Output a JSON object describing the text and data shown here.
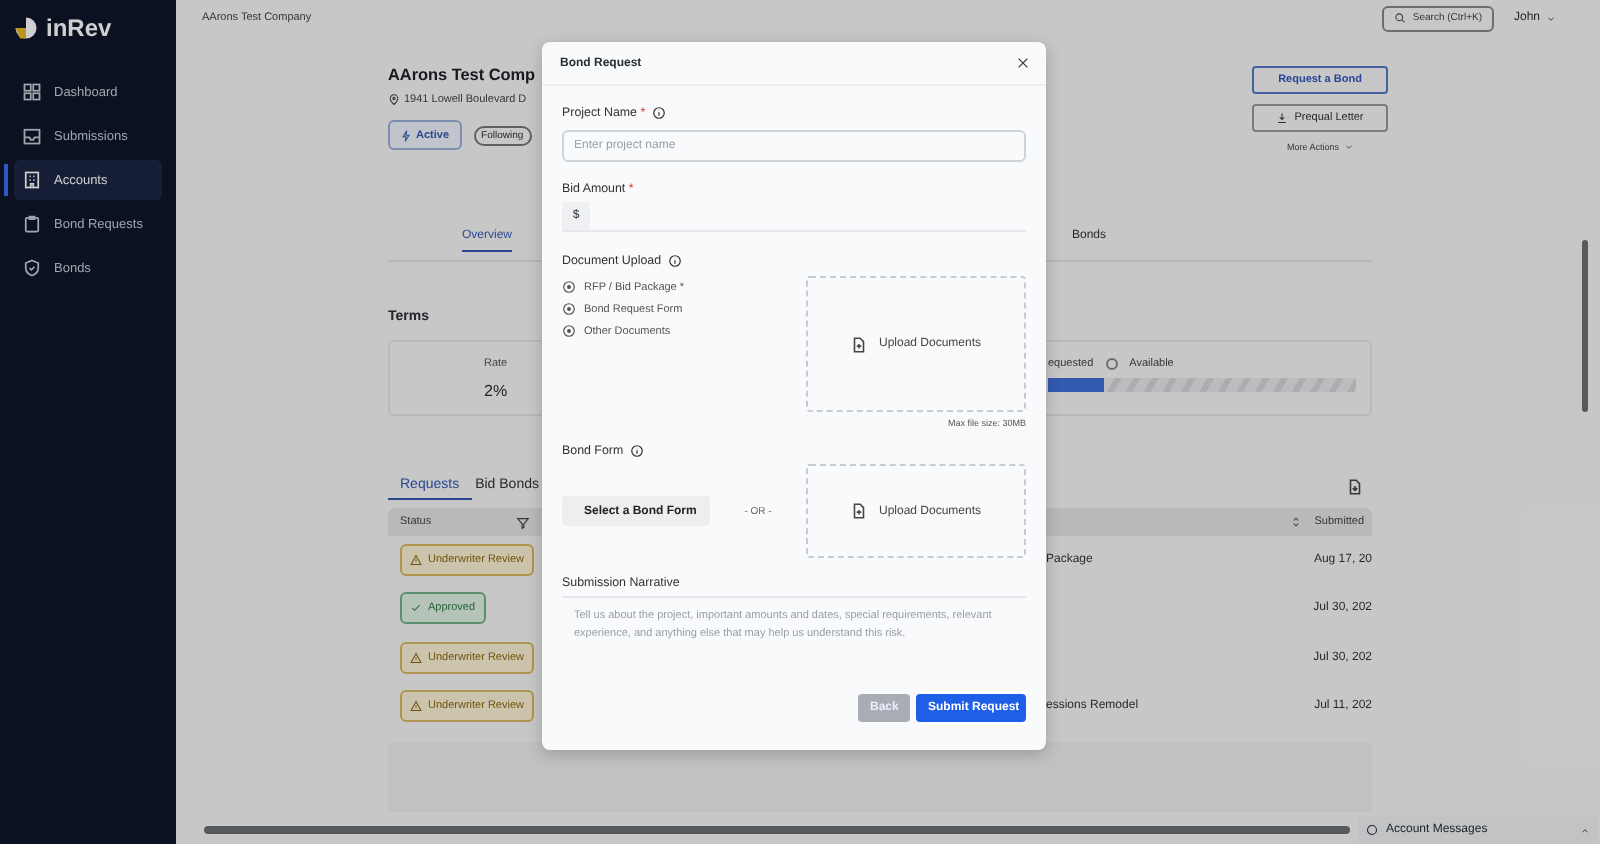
{
  "sidebar": {
    "logo": "inRev",
    "items": [
      {
        "label": "Dashboard",
        "selected": false
      },
      {
        "label": "Submissions",
        "selected": false
      },
      {
        "label": "Accounts",
        "selected": true
      },
      {
        "label": "Bond Requests",
        "selected": false
      },
      {
        "label": "Bonds",
        "selected": false
      }
    ]
  },
  "topbar": {
    "breadcrumb": "AArons Test Company",
    "search": "Search (Ctrl+K)",
    "user": "John"
  },
  "account": {
    "name": "AArons Test Comp",
    "address": "1941 Lowell Boulevard D",
    "status": "Active",
    "follow": "Following"
  },
  "actions": {
    "primary": "Request a Bond",
    "secondary": "Prequal Letter",
    "more": "More Actions"
  },
  "page_tabs": [
    {
      "label": "Overview",
      "selected": true
    },
    {
      "label": "Bonds",
      "selected": false
    }
  ],
  "terms": {
    "title": "Terms",
    "rate_label": "Rate",
    "rate": "2%",
    "legend": [
      "equested",
      "Available"
    ],
    "level": 0.18
  },
  "table": {
    "tabs": [
      {
        "label": "Requests",
        "selected": true
      },
      {
        "label": "Bid Bonds",
        "selected": false
      }
    ],
    "columns": [
      "Status",
      "Submitted"
    ],
    "rows": [
      {
        "status": "Underwriter Review",
        "kind": "review",
        "project": "Package",
        "submitted": "Aug 17, 20"
      },
      {
        "status": "Approved",
        "kind": "approved",
        "submitted": "Jul 30, 202"
      },
      {
        "status": "Underwriter Review",
        "kind": "review",
        "submitted": "Jul 30, 202"
      },
      {
        "status": "Underwriter Review",
        "kind": "review",
        "project": "essions Remodel",
        "submitted": "Jul 11, 202"
      }
    ]
  },
  "account_messages": "Account Messages",
  "modal": {
    "title": "Bond Request",
    "project_name": {
      "label": "Project Name",
      "required_mark": "*",
      "placeholder": "Enter project name"
    },
    "bid_amount": {
      "label": "Bid Amount",
      "required_mark": "*",
      "prefix": "$"
    },
    "document_upload": {
      "label": "Document Upload",
      "items": [
        "RFP / Bid Package *",
        "Bond Request Form",
        "Other Documents"
      ],
      "dropzone": "Upload Documents",
      "note": "Max file size: 30MB"
    },
    "bond_form": {
      "label": "Bond Form",
      "select": "Select a Bond Form",
      "or": "- OR -",
      "dropzone": "Upload Documents"
    },
    "narrative": {
      "label": "Submission Narrative",
      "placeholder": "Tell us about the project, important amounts and dates, special requirements, relevant experience, and anything else that may help us understand this risk."
    },
    "buttons": {
      "back": "Back",
      "submit": "Submit Request"
    }
  }
}
